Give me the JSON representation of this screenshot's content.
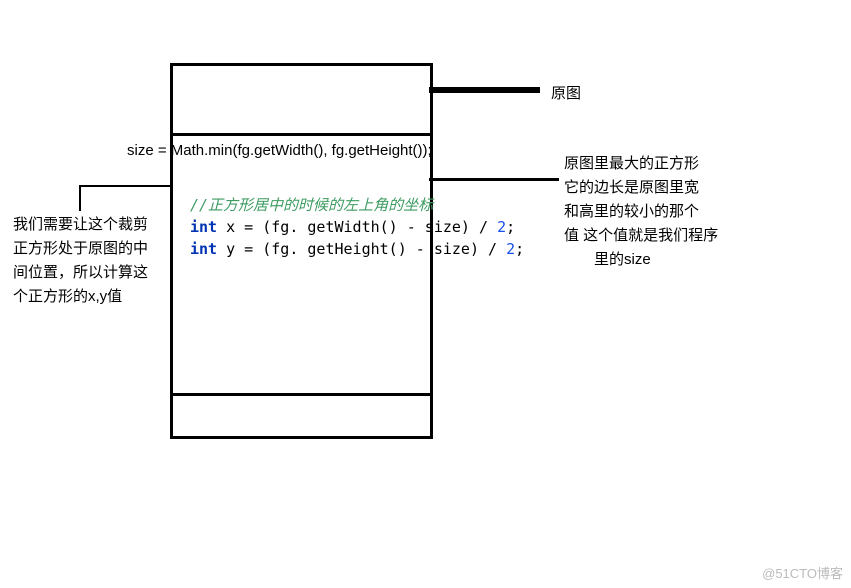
{
  "labels": {
    "orig_img": "原图",
    "right_note_l1": "原图里最大的正方形",
    "right_note_l2": "它的边长是原图里宽",
    "right_note_l3": "和高里的较小的那个",
    "right_note_l4": "值  这个值就是我们程序",
    "right_note_l5": "里的size",
    "left_note_l1": "我们需要让这个裁剪",
    "left_note_l2": "正方形处于原图的中",
    "left_note_l3": "间位置，所以计算这",
    "left_note_l4": "个正方形的x,y值"
  },
  "code": {
    "size_line_prefix": "size = ",
    "size_line_call": "Math.min(fg.getWidth(), fg.getHeight());",
    "comment": "//正方形居中的时候的左上角的坐标",
    "kw_int": "int",
    "x_expr_a": " x = (fg. getWidth() - size) / ",
    "y_expr_a": " y = (fg. getHeight() - size) / ",
    "num_two": "2",
    "semi": ";"
  },
  "watermark": "@51CTO博客"
}
